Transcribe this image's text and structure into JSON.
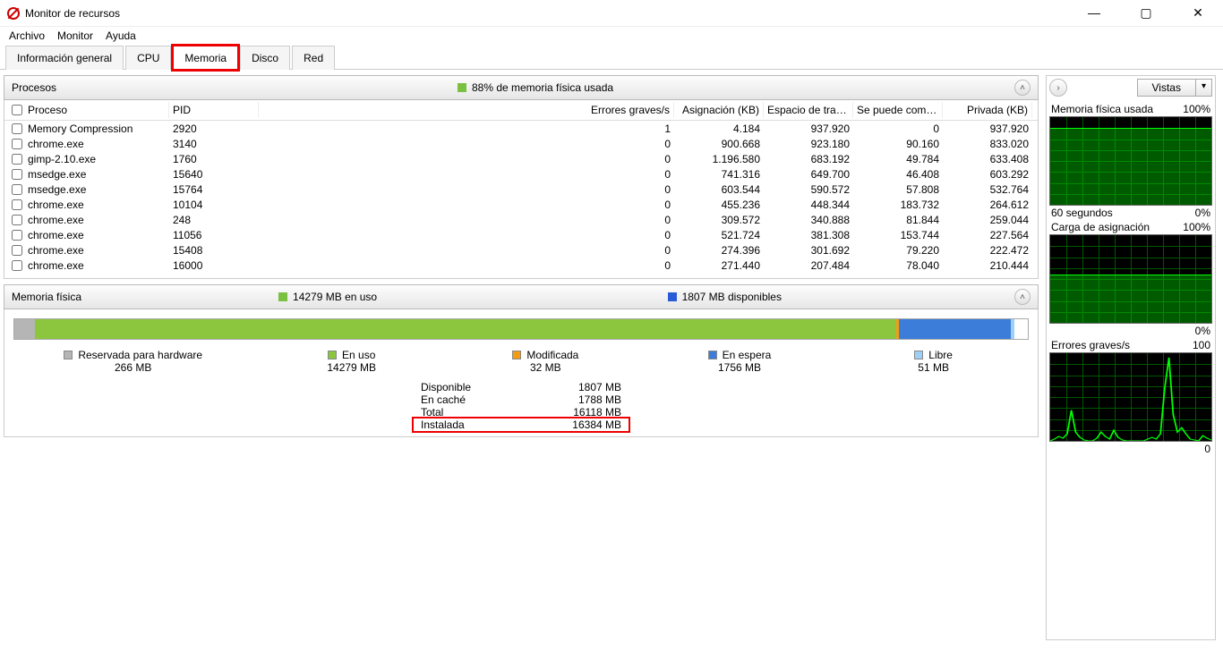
{
  "window": {
    "title": "Monitor de recursos"
  },
  "menubar": [
    "Archivo",
    "Monitor",
    "Ayuda"
  ],
  "tabs": [
    {
      "label": "Información general",
      "active": false
    },
    {
      "label": "CPU",
      "active": false
    },
    {
      "label": "Memoria",
      "active": true,
      "highlight": true
    },
    {
      "label": "Disco",
      "active": false
    },
    {
      "label": "Red",
      "active": false
    }
  ],
  "procesos": {
    "title": "Procesos",
    "legend_color": "#7ac142",
    "legend_text": "88% de memoria física usada",
    "columns": [
      "Proceso",
      "PID",
      "Errores graves/s",
      "Asignación (KB)",
      "Espacio de trab...",
      "Se puede comp...",
      "Privada (KB)"
    ],
    "rows": [
      {
        "name": "Memory Compression",
        "pid": "2920",
        "err": "1",
        "asig": "4.184",
        "ws": "937.920",
        "comp": "0",
        "priv": "937.920"
      },
      {
        "name": "chrome.exe",
        "pid": "3140",
        "err": "0",
        "asig": "900.668",
        "ws": "923.180",
        "comp": "90.160",
        "priv": "833.020"
      },
      {
        "name": "gimp-2.10.exe",
        "pid": "1760",
        "err": "0",
        "asig": "1.196.580",
        "ws": "683.192",
        "comp": "49.784",
        "priv": "633.408"
      },
      {
        "name": "msedge.exe",
        "pid": "15640",
        "err": "0",
        "asig": "741.316",
        "ws": "649.700",
        "comp": "46.408",
        "priv": "603.292"
      },
      {
        "name": "msedge.exe",
        "pid": "15764",
        "err": "0",
        "asig": "603.544",
        "ws": "590.572",
        "comp": "57.808",
        "priv": "532.764"
      },
      {
        "name": "chrome.exe",
        "pid": "10104",
        "err": "0",
        "asig": "455.236",
        "ws": "448.344",
        "comp": "183.732",
        "priv": "264.612"
      },
      {
        "name": "chrome.exe",
        "pid": "248",
        "err": "0",
        "asig": "309.572",
        "ws": "340.888",
        "comp": "81.844",
        "priv": "259.044"
      },
      {
        "name": "chrome.exe",
        "pid": "11056",
        "err": "0",
        "asig": "521.724",
        "ws": "381.308",
        "comp": "153.744",
        "priv": "227.564"
      },
      {
        "name": "chrome.exe",
        "pid": "15408",
        "err": "0",
        "asig": "274.396",
        "ws": "301.692",
        "comp": "79.220",
        "priv": "222.472"
      },
      {
        "name": "chrome.exe",
        "pid": "16000",
        "err": "0",
        "asig": "271.440",
        "ws": "207.484",
        "comp": "78.040",
        "priv": "210.444"
      }
    ]
  },
  "memoria_fisica": {
    "title": "Memoria física",
    "in_use_color": "#7ac142",
    "in_use_text": "14279 MB en uso",
    "avail_color": "#2a5bd7",
    "avail_text": "1807 MB disponibles",
    "bar": [
      {
        "color": "#b5b5b5",
        "pct": 2
      },
      {
        "color": "#8cc63f",
        "pct": 85
      },
      {
        "color": "#f39c12",
        "pct": 0.3
      },
      {
        "color": "#3b7dd8",
        "pct": 11
      },
      {
        "color": "#9ed0f6",
        "pct": 0.4
      },
      {
        "color": "#ffffff",
        "pct": 1.3
      }
    ],
    "legend": [
      {
        "color": "#b5b5b5",
        "label": "Reservada para hardware",
        "value": "266 MB"
      },
      {
        "color": "#8cc63f",
        "label": "En uso",
        "value": "14279 MB"
      },
      {
        "color": "#f39c12",
        "label": "Modificada",
        "value": "32 MB"
      },
      {
        "color": "#3b7dd8",
        "label": "En espera",
        "value": "1756 MB"
      },
      {
        "color": "#9ed0f6",
        "label": "Libre",
        "value": "51 MB"
      }
    ],
    "summary": [
      {
        "label": "Disponible",
        "value": "1807 MB",
        "hl": false
      },
      {
        "label": "En caché",
        "value": "1788 MB",
        "hl": false
      },
      {
        "label": "Total",
        "value": "16118 MB",
        "hl": false
      },
      {
        "label": "Instalada",
        "value": "16384 MB",
        "hl": true
      }
    ]
  },
  "right_panel": {
    "views_label": "Vistas",
    "charts": [
      {
        "title": "Memoria física usada",
        "right": "100%",
        "foot_left": "60 segundos",
        "foot_right": "0%",
        "type": "fill",
        "level_pct": 88
      },
      {
        "title": "Carga de asignación",
        "right": "100%",
        "foot_left": "",
        "foot_right": "0%",
        "type": "fill",
        "level_pct": 55
      },
      {
        "title": "Errores graves/s",
        "right": "100",
        "foot_left": "",
        "foot_right": "0",
        "type": "spark",
        "values": [
          0,
          2,
          5,
          3,
          8,
          35,
          10,
          4,
          1,
          0,
          0,
          3,
          10,
          5,
          2,
          12,
          4,
          1,
          0,
          0,
          0,
          0,
          0,
          2,
          4,
          2,
          8,
          60,
          95,
          30,
          10,
          15,
          8,
          2,
          1,
          0,
          6,
          3,
          1
        ]
      }
    ]
  },
  "chart_data": [
    {
      "type": "area",
      "title": "Memoria física usada",
      "ylabel": "%",
      "ylim": [
        0,
        100
      ],
      "xlabel": "60 segundos",
      "values_pct_constant": 88
    },
    {
      "type": "area",
      "title": "Carga de asignación",
      "ylabel": "%",
      "ylim": [
        0,
        100
      ],
      "values_pct_constant": 55
    },
    {
      "type": "line",
      "title": "Errores graves/s",
      "ylim": [
        0,
        100
      ],
      "x_seconds": 60,
      "values": [
        0,
        2,
        5,
        3,
        8,
        35,
        10,
        4,
        1,
        0,
        0,
        3,
        10,
        5,
        2,
        12,
        4,
        1,
        0,
        0,
        0,
        0,
        0,
        2,
        4,
        2,
        8,
        60,
        95,
        30,
        10,
        15,
        8,
        2,
        1,
        0,
        6,
        3,
        1
      ]
    },
    {
      "type": "bar",
      "title": "Memoria física",
      "categories": [
        "Reservada para hardware",
        "En uso",
        "Modificada",
        "En espera",
        "Libre"
      ],
      "values_mb": [
        266,
        14279,
        32,
        1756,
        51
      ]
    }
  ]
}
